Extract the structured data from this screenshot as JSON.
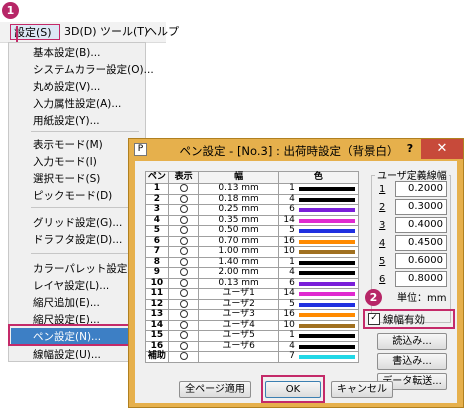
{
  "menubar": {
    "items": [
      "設定(S)",
      "3D(D)",
      "ツール(T)",
      "ヘルプ"
    ]
  },
  "settings_menu": {
    "items": [
      "基本設定(B)...",
      "システムカラー設定(O)...",
      "丸め設定(V)...",
      "入力属性設定(A)...",
      "用紙設定(Y)...",
      "表示モード(M)",
      "入力モード(I)",
      "選択モード(S)",
      "ピックモード(D)",
      "グリッド設定(G)...",
      "ドラフタ設定(D)...",
      "カラーパレット設定(C)...",
      "レイヤ設定(L)...",
      "縮尺追加(E)...",
      "縮尺設定(E)...",
      "ペン設定(N)...",
      "線幅設定(U)..."
    ]
  },
  "badges": {
    "step1": "1",
    "step2": "2"
  },
  "dialog": {
    "title": "ペン設定 - [No.3] : 出荷時設定（背景白）",
    "help": "?",
    "close": "✕",
    "app_icon": "P",
    "table": {
      "headers": [
        "ペン",
        "表示",
        "幅",
        "色"
      ],
      "rows": [
        {
          "pen": "1",
          "width": "0.13 mm",
          "color_num": "1",
          "color": "#000000"
        },
        {
          "pen": "2",
          "width": "0.18 mm",
          "color_num": "4",
          "color": "#000000"
        },
        {
          "pen": "3",
          "width": "0.25 mm",
          "color_num": "6",
          "color": "#7a1fd9"
        },
        {
          "pen": "4",
          "width": "0.35 mm",
          "color_num": "14",
          "color": "#e02ad0"
        },
        {
          "pen": "5",
          "width": "0.50 mm",
          "color_num": "5",
          "color": "#2030e0"
        },
        {
          "pen": "6",
          "width": "0.70 mm",
          "color_num": "16",
          "color": "#ff8a00"
        },
        {
          "pen": "7",
          "width": "1.00 mm",
          "color_num": "10",
          "color": "#a07020"
        },
        {
          "pen": "8",
          "width": "1.40 mm",
          "color_num": "1",
          "color": "#000000"
        },
        {
          "pen": "9",
          "width": "2.00 mm",
          "color_num": "4",
          "color": "#000000"
        },
        {
          "pen": "10",
          "width": "0.13 mm",
          "color_num": "6",
          "color": "#7a1fd9"
        },
        {
          "pen": "11",
          "width": "ユーザ1",
          "color_num": "14",
          "color": "#e02ad0"
        },
        {
          "pen": "12",
          "width": "ユーザ2",
          "color_num": "5",
          "color": "#2030e0"
        },
        {
          "pen": "13",
          "width": "ユーザ3",
          "color_num": "16",
          "color": "#ff8a00"
        },
        {
          "pen": "14",
          "width": "ユーザ4",
          "color_num": "10",
          "color": "#a07020"
        },
        {
          "pen": "15",
          "width": "ユーザ5",
          "color_num": "1",
          "color": "#000000"
        },
        {
          "pen": "16",
          "width": "ユーザ6",
          "color_num": "4",
          "color": "#000000"
        },
        {
          "pen": "補助",
          "width": "",
          "color_num": "7",
          "color": "#22d8e6"
        }
      ]
    },
    "user_widths": {
      "title": "ユーザ定義線幅",
      "items": [
        {
          "num": "1",
          "value": "0.2000"
        },
        {
          "num": "2",
          "value": "0.3000"
        },
        {
          "num": "3",
          "value": "0.4000"
        },
        {
          "num": "4",
          "value": "0.4500"
        },
        {
          "num": "5",
          "value": "0.6000"
        },
        {
          "num": "6",
          "value": "0.8000"
        }
      ],
      "unit": "単位：mm"
    },
    "line_width_checkbox": {
      "label": "線幅有効",
      "checked": "✓"
    },
    "buttons": {
      "load": "読込み...",
      "save": "書込み...",
      "transfer": "データ転送...",
      "apply_all": "全ページ適用",
      "ok": "OK",
      "cancel": "キャンセル"
    }
  }
}
